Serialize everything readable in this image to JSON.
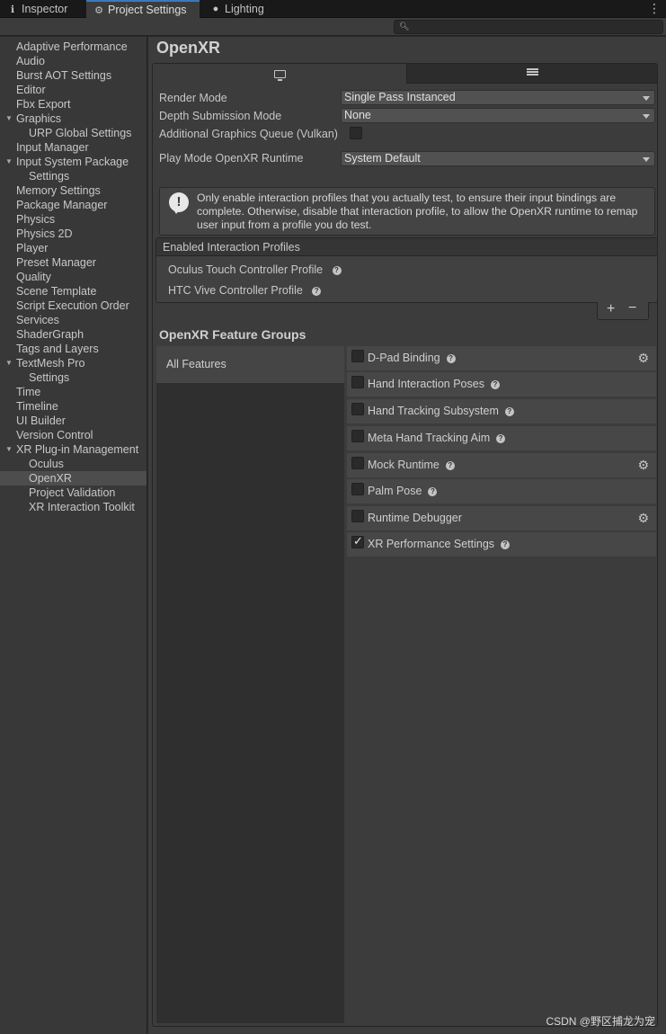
{
  "tabs": [
    {
      "label": "Inspector",
      "icon": "info-icon"
    },
    {
      "label": "Project Settings",
      "icon": "gear-icon"
    },
    {
      "label": "Lighting",
      "icon": "bulb-icon"
    }
  ],
  "sidebar": {
    "items": [
      {
        "label": "Adaptive Performance"
      },
      {
        "label": "Audio"
      },
      {
        "label": "Burst AOT Settings"
      },
      {
        "label": "Editor"
      },
      {
        "label": "Fbx Export"
      },
      {
        "label": "Graphics"
      },
      {
        "label": "URP Global Settings"
      },
      {
        "label": "Input Manager"
      },
      {
        "label": "Input System Package"
      },
      {
        "label": "Settings"
      },
      {
        "label": "Memory Settings"
      },
      {
        "label": "Package Manager"
      },
      {
        "label": "Physics"
      },
      {
        "label": "Physics 2D"
      },
      {
        "label": "Player"
      },
      {
        "label": "Preset Manager"
      },
      {
        "label": "Quality"
      },
      {
        "label": "Scene Template"
      },
      {
        "label": "Script Execution Order"
      },
      {
        "label": "Services"
      },
      {
        "label": "ShaderGraph"
      },
      {
        "label": "Tags and Layers"
      },
      {
        "label": "TextMesh Pro"
      },
      {
        "label": "Settings"
      },
      {
        "label": "Time"
      },
      {
        "label": "Timeline"
      },
      {
        "label": "UI Builder"
      },
      {
        "label": "Version Control"
      },
      {
        "label": "XR Plug-in Management"
      },
      {
        "label": "Oculus"
      },
      {
        "label": "OpenXR"
      },
      {
        "label": "Project Validation"
      },
      {
        "label": "XR Interaction Toolkit"
      }
    ],
    "selected": "OpenXR"
  },
  "main": {
    "title": "OpenXR",
    "settings": {
      "render_mode_label": "Render Mode",
      "render_mode_value": "Single Pass Instanced",
      "depth_label": "Depth Submission Mode",
      "depth_value": "None",
      "queue_label": "Additional Graphics Queue (Vulkan)",
      "queue_checked": false,
      "runtime_label": "Play Mode OpenXR Runtime",
      "runtime_value": "System Default"
    },
    "help_message": "Only enable interaction profiles that you actually test, to ensure their input bindings are complete. Otherwise, disable that interaction profile, to allow the OpenXR runtime to remap user input from a profile you do test.",
    "profiles": {
      "header": "Enabled Interaction Profiles",
      "items": [
        "Oculus Touch Controller Profile",
        "HTC Vive Controller Profile"
      ],
      "add_label": "+",
      "remove_label": "−"
    },
    "feature_groups": {
      "title": "OpenXR Feature Groups",
      "all_label": "All Features",
      "features": [
        {
          "name": "D-Pad Binding",
          "checked": false,
          "help": true,
          "gear": true
        },
        {
          "name": "Hand Interaction Poses",
          "checked": false,
          "help": true,
          "gear": false
        },
        {
          "name": "Hand Tracking Subsystem",
          "checked": false,
          "help": true,
          "gear": false
        },
        {
          "name": "Meta Hand Tracking Aim",
          "checked": false,
          "help": true,
          "gear": false
        },
        {
          "name": "Mock Runtime",
          "checked": false,
          "help": true,
          "gear": true
        },
        {
          "name": "Palm Pose",
          "checked": false,
          "help": true,
          "gear": false
        },
        {
          "name": "Runtime Debugger",
          "checked": false,
          "help": false,
          "gear": true
        },
        {
          "name": "XR Performance Settings",
          "checked": true,
          "help": true,
          "gear": false
        }
      ]
    }
  },
  "watermark": "CSDN @野区捕龙为宠"
}
